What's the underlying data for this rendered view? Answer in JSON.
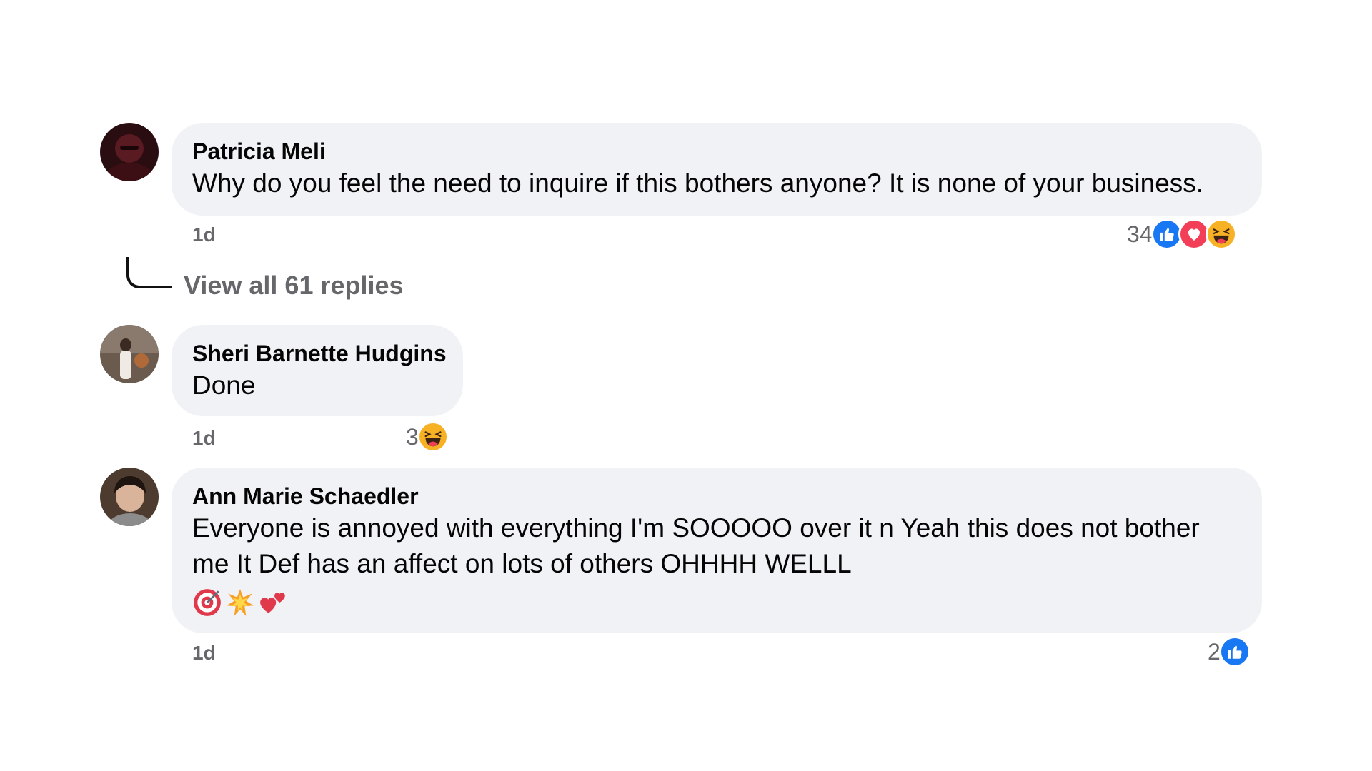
{
  "comments": [
    {
      "author": "Patricia Meli",
      "text": "Why do you feel the need to inquire if this bothers anyone? It is none of your business.",
      "time": "1d",
      "reaction_count": "34",
      "reactions": [
        "like-icon",
        "love-icon",
        "haha-icon"
      ]
    },
    {
      "author": "Sheri Barnette Hudgins",
      "text": "Done",
      "time": "1d",
      "reaction_count": "3",
      "reactions": [
        "haha-icon"
      ]
    },
    {
      "author": "Ann Marie Schaedler",
      "text": "Everyone is annoyed with everything I'm SOOOOO over it n Yeah this does not bother me It Def has an affect on lots of others OHHHH WELLL",
      "emojis": [
        "🎯",
        "💥",
        "💕"
      ],
      "time": "1d",
      "reaction_count": "2",
      "reactions": [
        "like-icon"
      ]
    }
  ],
  "view_replies_label": "View all 61 replies",
  "colors": {
    "bubble": "#f0f2f5",
    "meta_text": "#65676b",
    "like": "#1877f2",
    "love": "#f33e58",
    "haha": "#f7b125"
  }
}
